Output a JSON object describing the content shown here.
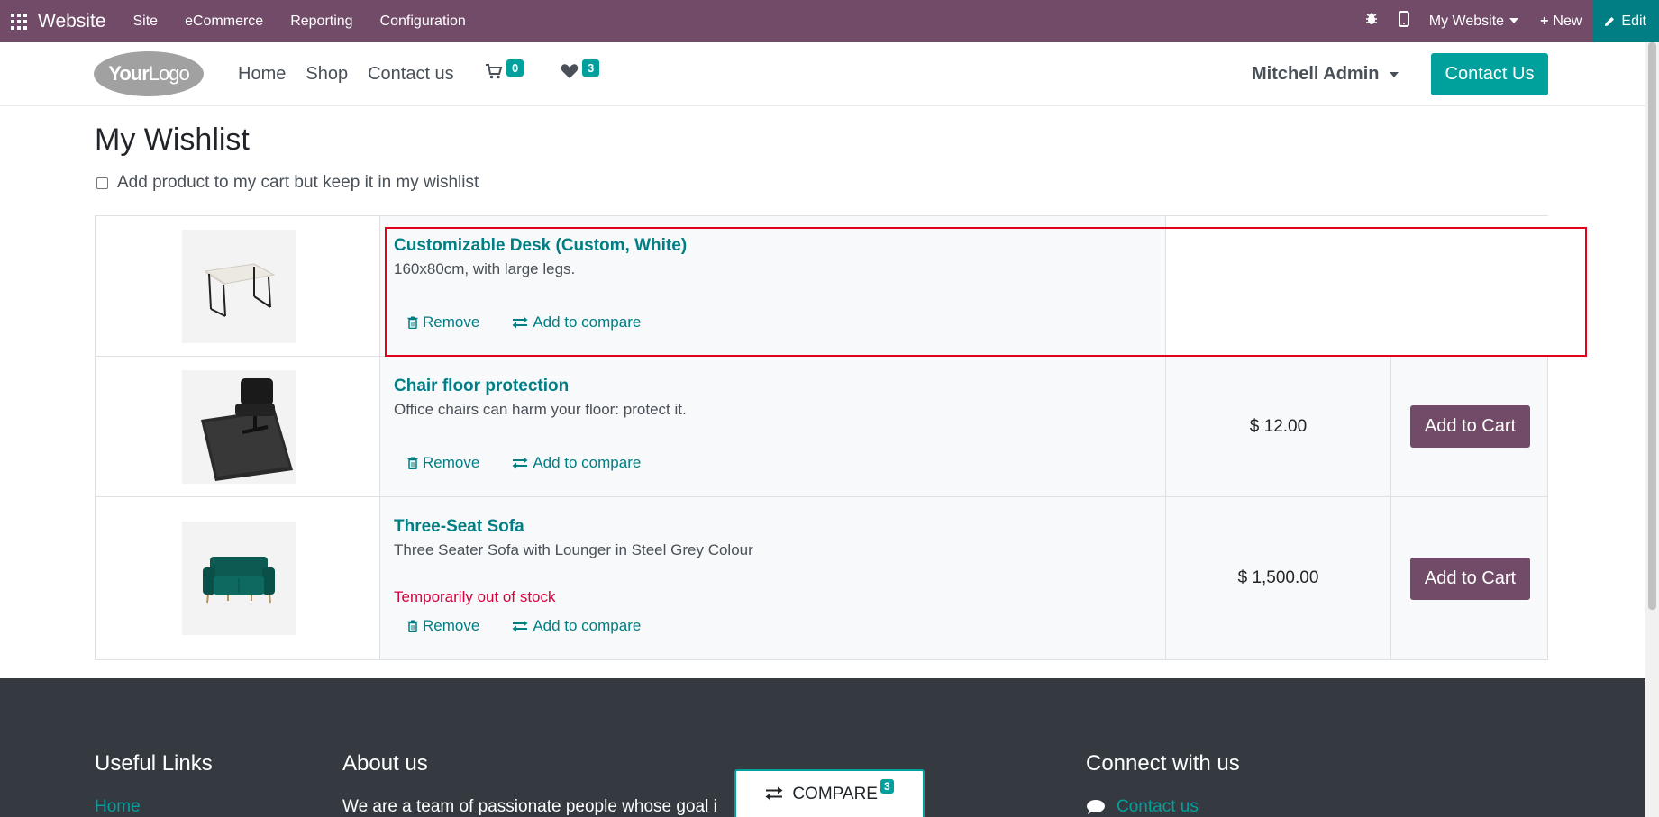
{
  "adminbar": {
    "brand": "Website",
    "menu": [
      "Site",
      "eCommerce",
      "Reporting",
      "Configuration"
    ],
    "website_switcher": "My Website",
    "new_label": "New",
    "edit_label": "Edit"
  },
  "header": {
    "logo_bold": "Your",
    "logo_thin": "Logo",
    "nav": [
      "Home",
      "Shop",
      "Contact us"
    ],
    "cart_count": "0",
    "wishlist_count": "3",
    "user": "Mitchell Admin",
    "contact_button": "Contact Us"
  },
  "page": {
    "title": "My Wishlist",
    "keep_checkbox_label": "Add product to my cart but keep it in my wishlist",
    "remove_label": "Remove",
    "compare_label": "Add to compare",
    "add_to_cart_label": "Add to Cart"
  },
  "wishlist": [
    {
      "name": "Customizable Desk (Custom, White)",
      "description": "160x80cm, with large legs.",
      "price": "",
      "stock_note": ""
    },
    {
      "name": "Chair floor protection",
      "description": "Office chairs can harm your floor: protect it.",
      "price": "$ 12.00",
      "stock_note": ""
    },
    {
      "name": "Three-Seat Sofa",
      "description": "Three Seater Sofa with Lounger in Steel Grey Colour",
      "price": "$ 1,500.00",
      "stock_note": "Temporarily out of stock"
    }
  ],
  "footer": {
    "useful_links_title": "Useful Links",
    "useful_links_first": "Home",
    "about_title": "About us",
    "about_text": "We are a team of passionate people whose goal i",
    "connect_title": "Connect with us",
    "connect_first": "Contact us"
  },
  "compare_bar": {
    "label": "COMPARE",
    "count": "3"
  },
  "colors": {
    "admin_bar": "#714b67",
    "accent_teal": "#00a09d",
    "link_teal": "#017e84",
    "cart_button": "#714b67",
    "out_of_stock": "#d6003d",
    "footer": "#343a40",
    "highlight": "#e3001b"
  }
}
